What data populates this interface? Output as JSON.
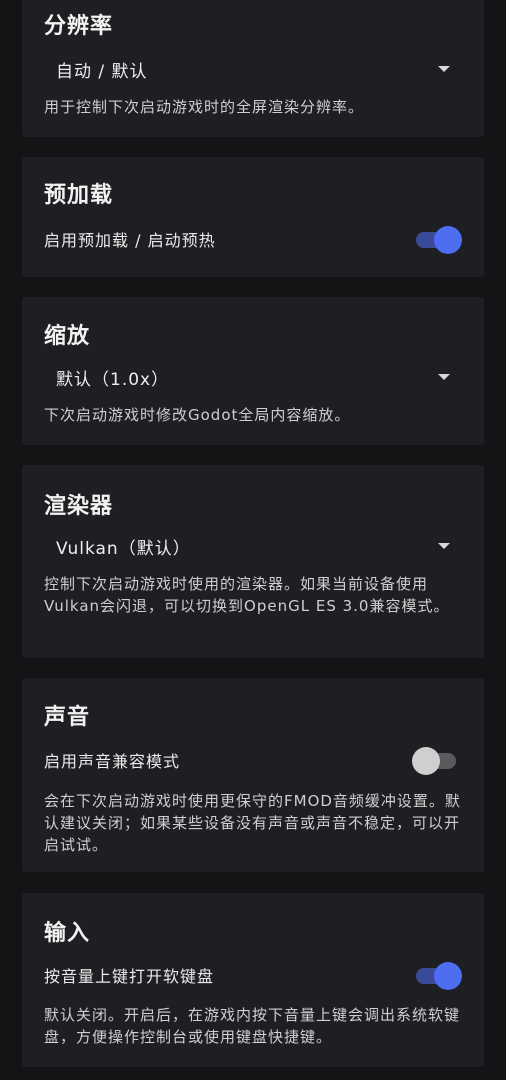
{
  "resolution": {
    "title": "分辨率",
    "selected": "自动 / 默认",
    "description": "用于控制下次启动游戏时的全屏渲染分辨率。"
  },
  "preload": {
    "title": "预加载",
    "toggle_label": "启用预加载 / 启动预热",
    "enabled": true
  },
  "scale": {
    "title": "缩放",
    "selected": "默认（1.0x）",
    "description": "下次启动游戏时修改Godot全局内容缩放。"
  },
  "renderer": {
    "title": "渲染器",
    "selected": "Vulkan（默认）",
    "description": "控制下次启动游戏时使用的渲染器。如果当前设备使用Vulkan会闪退，可以切换到OpenGL ES 3.0兼容模式。"
  },
  "audio": {
    "title": "声音",
    "toggle_label": "启用声音兼容模式",
    "enabled": false,
    "description": "会在下次启动游戏时使用更保守的FMOD音频缓冲设置。默认建议关闭；如果某些设备没有声音或声音不稳定，可以开启试试。"
  },
  "input": {
    "title": "输入",
    "toggle_label": "按音量上键打开软键盘",
    "enabled": true,
    "description": "默认关闭。开启后，在游戏内按下音量上键会调出系统软键盘，方便操作控制台或使用键盘快捷键。"
  },
  "colors": {
    "accent": "#4d6ef0",
    "card": "#1e1f22",
    "background": "#131416"
  }
}
